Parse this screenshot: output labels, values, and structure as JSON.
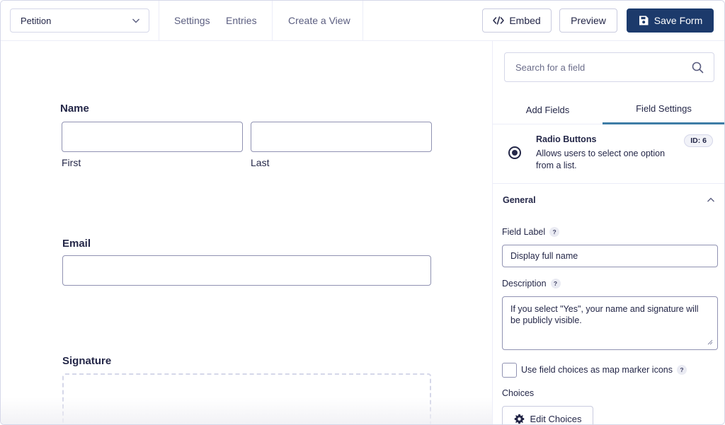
{
  "topbar": {
    "form_name": "Petition",
    "nav": {
      "settings": "Settings",
      "entries": "Entries",
      "create_view": "Create a View"
    },
    "embed_label": "Embed",
    "preview_label": "Preview",
    "save_label": "Save Form",
    "colors": {
      "primary": "#1c3a6b"
    }
  },
  "form": {
    "name": {
      "label": "Name",
      "first": "First",
      "last": "Last"
    },
    "email": {
      "label": "Email"
    },
    "signature": {
      "label": "Signature"
    }
  },
  "sidebar": {
    "search_placeholder": "Search for a field",
    "tabs": {
      "add_fields": "Add Fields",
      "field_settings": "Field Settings"
    },
    "field_type": {
      "title": "Radio Buttons",
      "description": "Allows users to select one option from a list.",
      "id_badge": "ID: 6"
    },
    "general": {
      "heading": "General",
      "field_label": {
        "label": "Field Label",
        "value": "Display full name"
      },
      "description": {
        "label": "Description",
        "value": "If you select \"Yes\", your name and signature will be publicly visible."
      },
      "map_marker": {
        "label": "Use field choices as map marker icons"
      },
      "choices": {
        "label": "Choices",
        "button": "Edit Choices"
      }
    },
    "help_glyph": "?"
  }
}
